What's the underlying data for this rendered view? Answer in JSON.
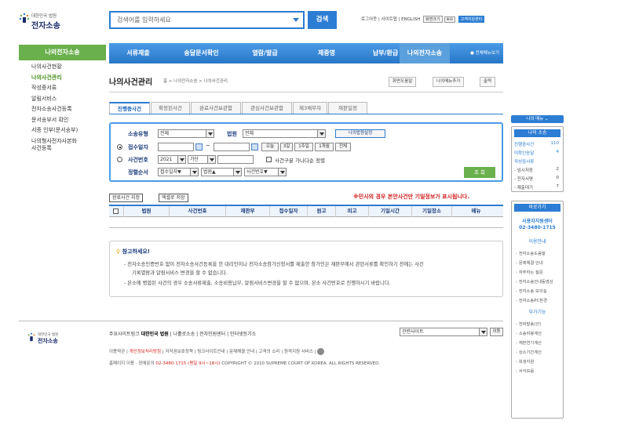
{
  "header": {
    "logo_small": "대한민국 법원",
    "logo_big": "전자소송",
    "search_placeholder": "검색어를 입력하세요",
    "search_button": "검색",
    "top_links": "로그아웃 | 사이트맵 | ENGLISH",
    "zoom_label": "화면크기",
    "zoom_buttons": "⊕⊖",
    "help_center": "고객지원센터"
  },
  "nav": {
    "items": [
      "서류제출",
      "송달문서확인",
      "열람/발급",
      "제증명",
      "납부/환급",
      "나의전자소송"
    ],
    "all_menu": "● 전체메뉴보기"
  },
  "left_menu": {
    "title": "나의전자소송",
    "items": [
      "나의사건현황",
      "나의사건관리",
      "작성중서류",
      "알림서비스",
      "전자소송사건등록",
      "문서송부서 확인",
      "서증 인부(문서송부)",
      "나의형사전자사본화",
      "사건등록"
    ]
  },
  "page": {
    "title": "나의사건관리",
    "breadcrumb": "홈 > 나의전자소송 > 나의사건관리",
    "util": [
      "화면도움말",
      "나의메뉴추가",
      "출력"
    ]
  },
  "tabs": [
    "진행중사건",
    "확정된사건",
    "완료사건보관함",
    "관심사건보관함",
    "제3채무자",
    "재판일정"
  ],
  "form": {
    "case_type_label": "소송유형",
    "case_type_value": "전체",
    "court_label": "법원",
    "court_value": "전체",
    "my_court_btn": "나의법원설정",
    "receipt_label": "접수일자",
    "tilde": "~",
    "date_btns": [
      "오늘",
      "3일",
      "1주일",
      "1개월",
      "전체"
    ],
    "case_no_label": "사건번호",
    "year_value": "2021",
    "gubun_value": "가단",
    "sort_check_label": "사건구분 가나다순 정렬",
    "order_label": "정렬순서",
    "order_values": [
      "접수일자▼",
      "법원▲",
      "사건번호▼"
    ],
    "search_btn": "조 회"
  },
  "table": {
    "btn_archive": "완료사건 지정",
    "btn_excel": "엑셀로 저장",
    "warning": "※민사의 경우 본안사건만 기일정보가 표시됩니다.",
    "headers": [
      "법원",
      "사건번호",
      "재판부",
      "접수일자",
      "원고",
      "피고",
      "기일시간",
      "기일장소",
      "메뉴"
    ]
  },
  "notice": {
    "title": "참고하세요!",
    "lines": [
      "- 전자소송인증번호 없이 전자소송사건등록을 한 대리인이나 전자소송참가신청서를 제출한 참가인은 재판부에서 관련서류를 확인하기 전에는 사건",
      "기록열람과 알림서비스 변경을 할 수 없습니다.",
      "- 본소에 병합된 사건의 경우 소송서류제출, 소송비용납부, 알림서비스변경을 할 수 없으며, 본소 사건번호로 진행하시기 바랍니다."
    ]
  },
  "footer": {
    "links": "주요사이트링크 ",
    "links_bold": [
      "대한민국 법원",
      "나홀로소송",
      "전자민원센터",
      "인터넷등기소"
    ],
    "site_select": "관련사이트",
    "go": "이동",
    "line1_pre": "이용약관 | ",
    "line1_red": "개인정보처리방침",
    "line1_post": " | 저작권보호정책 | 링크사이트안내 | 문제해결 안내 | 고객의 소리 | 원격지원 서비스 |",
    "line2_pre": "홈페이지 이용 · 장애문의 ",
    "line2_red": "02-3480-1715 (평일 9시~18시)",
    "line2_post": "   COPYRIGHT © 2010 SUPREME COURT OF KOREA. ALL RIGHTS RESERVED."
  },
  "right_sidebar": {
    "my_menu": "나의 메뉴 ⌄",
    "my_case_title": "나의 소송",
    "my_case_rows": [
      {
        "label": "진행중사건",
        "value": "110",
        "blue": true
      },
      {
        "label": "미확인송달",
        "value": "4",
        "blue": true
      },
      {
        "label": "작성중서류",
        "value": "",
        "blue": true
      },
      {
        "label": "- 임시저장",
        "value": "2",
        "blue": false
      },
      {
        "label": "- 전자서명",
        "value": "0",
        "blue": false
      },
      {
        "label": "- 제출대기",
        "value": "7",
        "blue": false
      }
    ],
    "shortcut_title": "바로가기",
    "center": "사용자지원센터",
    "center_phone": "02-3480-1715",
    "usage_title": "이용안내",
    "usage_items": [
      "전자소송도움말",
      "문제해결 안내",
      "자주하는 질문",
      "전자소송안내동영상",
      "전자소송 모의실",
      "전자소송PC환경"
    ],
    "calc_title": "부가기능",
    "calc_items": [
      "전화발송(안)",
      "소송비용계산",
      "재판연기계산",
      "상소기간계산",
      "회생지원",
      "서식모음"
    ]
  }
}
